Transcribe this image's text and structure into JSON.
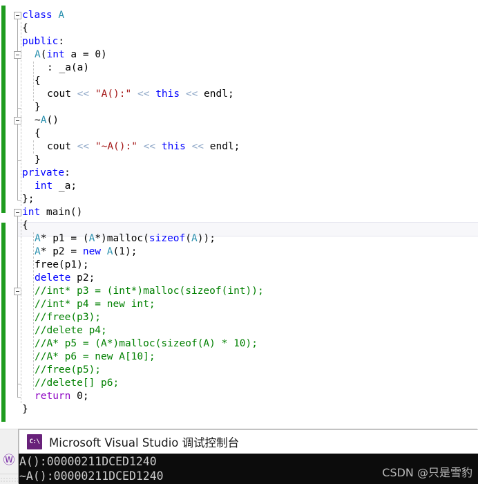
{
  "editor": {
    "language": "C++",
    "theme_colors": {
      "background": "#ffffff",
      "keyword": "#0000ff",
      "control_keyword": "#8f08c4",
      "class_type": "#2b91af",
      "string": "#a31515",
      "comment": "#008000",
      "operator": "#8fa8c8",
      "plain_text": "#000000",
      "change_bar": "#1e9b1e",
      "current_line_highlight": "#f7f7fa"
    },
    "current_line_index": 16,
    "lines": [
      {
        "indent": 0,
        "tokens": [
          {
            "t": "class ",
            "c": "kw"
          },
          {
            "t": "A",
            "c": "cls"
          }
        ]
      },
      {
        "indent": 0,
        "tokens": [
          {
            "t": "{",
            "c": "pln"
          }
        ]
      },
      {
        "indent": 0,
        "tokens": [
          {
            "t": "public",
            "c": "kw"
          },
          {
            "t": ":",
            "c": "pln"
          }
        ]
      },
      {
        "indent": 1,
        "tokens": [
          {
            "t": "A",
            "c": "cls"
          },
          {
            "t": "(",
            "c": "pln"
          },
          {
            "t": "int",
            "c": "kw"
          },
          {
            "t": " a = 0)",
            "c": "pln"
          }
        ]
      },
      {
        "indent": 2,
        "tokens": [
          {
            "t": ": _a(a)",
            "c": "pln"
          }
        ]
      },
      {
        "indent": 1,
        "tokens": [
          {
            "t": "{",
            "c": "pln"
          }
        ]
      },
      {
        "indent": 2,
        "tokens": [
          {
            "t": "cout ",
            "c": "pln"
          },
          {
            "t": "<<",
            "c": "op"
          },
          {
            "t": " ",
            "c": "pln"
          },
          {
            "t": "\"A():\"",
            "c": "str"
          },
          {
            "t": " ",
            "c": "pln"
          },
          {
            "t": "<<",
            "c": "op"
          },
          {
            "t": " ",
            "c": "pln"
          },
          {
            "t": "this",
            "c": "kw"
          },
          {
            "t": " ",
            "c": "pln"
          },
          {
            "t": "<<",
            "c": "op"
          },
          {
            "t": " endl;",
            "c": "pln"
          }
        ]
      },
      {
        "indent": 1,
        "tokens": [
          {
            "t": "}",
            "c": "pln"
          }
        ]
      },
      {
        "indent": 1,
        "tokens": [
          {
            "t": "~",
            "c": "pln"
          },
          {
            "t": "A",
            "c": "cls"
          },
          {
            "t": "()",
            "c": "pln"
          }
        ]
      },
      {
        "indent": 1,
        "tokens": [
          {
            "t": "{",
            "c": "pln"
          }
        ]
      },
      {
        "indent": 2,
        "tokens": [
          {
            "t": "cout ",
            "c": "pln"
          },
          {
            "t": "<<",
            "c": "op"
          },
          {
            "t": " ",
            "c": "pln"
          },
          {
            "t": "\"~A():\"",
            "c": "str"
          },
          {
            "t": " ",
            "c": "pln"
          },
          {
            "t": "<<",
            "c": "op"
          },
          {
            "t": " ",
            "c": "pln"
          },
          {
            "t": "this",
            "c": "kw"
          },
          {
            "t": " ",
            "c": "pln"
          },
          {
            "t": "<<",
            "c": "op"
          },
          {
            "t": " endl;",
            "c": "pln"
          }
        ]
      },
      {
        "indent": 1,
        "tokens": [
          {
            "t": "}",
            "c": "pln"
          }
        ]
      },
      {
        "indent": 0,
        "tokens": [
          {
            "t": "private",
            "c": "kw"
          },
          {
            "t": ":",
            "c": "pln"
          }
        ]
      },
      {
        "indent": 1,
        "tokens": [
          {
            "t": "int",
            "c": "kw"
          },
          {
            "t": " _a;",
            "c": "pln"
          }
        ]
      },
      {
        "indent": 0,
        "tokens": [
          {
            "t": "};",
            "c": "pln"
          }
        ]
      },
      {
        "indent": 0,
        "tokens": [
          {
            "t": "int",
            "c": "kw"
          },
          {
            "t": " main()",
            "c": "pln"
          }
        ]
      },
      {
        "indent": 0,
        "tokens": [
          {
            "t": "{",
            "c": "pln"
          }
        ]
      },
      {
        "indent": 1,
        "tokens": [
          {
            "t": "A",
            "c": "cls"
          },
          {
            "t": "* p1 = (",
            "c": "pln"
          },
          {
            "t": "A",
            "c": "cls"
          },
          {
            "t": "*)malloc(",
            "c": "pln"
          },
          {
            "t": "sizeof",
            "c": "kw"
          },
          {
            "t": "(",
            "c": "pln"
          },
          {
            "t": "A",
            "c": "cls"
          },
          {
            "t": "));",
            "c": "pln"
          }
        ]
      },
      {
        "indent": 1,
        "tokens": [
          {
            "t": "A",
            "c": "cls"
          },
          {
            "t": "* p2 = ",
            "c": "pln"
          },
          {
            "t": "new",
            "c": "kw"
          },
          {
            "t": " ",
            "c": "pln"
          },
          {
            "t": "A",
            "c": "cls"
          },
          {
            "t": "(1);",
            "c": "pln"
          }
        ]
      },
      {
        "indent": 1,
        "tokens": [
          {
            "t": "free(p1);",
            "c": "pln"
          }
        ]
      },
      {
        "indent": 1,
        "tokens": [
          {
            "t": "delete",
            "c": "kw"
          },
          {
            "t": " p2;",
            "c": "pln"
          }
        ]
      },
      {
        "indent": 1,
        "tokens": [
          {
            "t": "//int* p3 = (int*)malloc(sizeof(int));",
            "c": "cmt"
          }
        ]
      },
      {
        "indent": 1,
        "tokens": [
          {
            "t": "//int* p4 = new int;",
            "c": "cmt"
          }
        ]
      },
      {
        "indent": 1,
        "tokens": [
          {
            "t": "//free(p3);",
            "c": "cmt"
          }
        ]
      },
      {
        "indent": 1,
        "tokens": [
          {
            "t": "//delete p4;",
            "c": "cmt"
          }
        ]
      },
      {
        "indent": 1,
        "tokens": [
          {
            "t": "//A* p5 = (A*)malloc(sizeof(A) * 10);",
            "c": "cmt"
          }
        ]
      },
      {
        "indent": 1,
        "tokens": [
          {
            "t": "//A* p6 = new A[10];",
            "c": "cmt"
          }
        ]
      },
      {
        "indent": 1,
        "tokens": [
          {
            "t": "//free(p5);",
            "c": "cmt"
          }
        ]
      },
      {
        "indent": 1,
        "tokens": [
          {
            "t": "//delete[] p6;",
            "c": "cmt"
          }
        ]
      },
      {
        "indent": 1,
        "tokens": [
          {
            "t": "return",
            "c": "ctl"
          },
          {
            "t": " 0;",
            "c": "pln"
          }
        ]
      },
      {
        "indent": 0,
        "tokens": [
          {
            "t": "}",
            "c": "pln"
          }
        ]
      }
    ],
    "fold_markers": [
      {
        "line": 0,
        "state": "expanded"
      },
      {
        "line": 3,
        "state": "expanded"
      },
      {
        "line": 8,
        "state": "expanded"
      },
      {
        "line": 15,
        "state": "expanded"
      },
      {
        "line": 21,
        "state": "expanded"
      }
    ]
  },
  "console": {
    "title": "Microsoft Visual Studio 调试控制台",
    "icon": "console-app-icon",
    "icon_glyph": "C:\\",
    "output_lines": [
      "A():00000211DCED1240",
      "~A():00000211DCED1240"
    ]
  },
  "watermark": {
    "text": "CSDN @只是雪豹"
  },
  "taskbar": {
    "icon": "assistant-icon",
    "icon_glyph": "Ⓦ"
  }
}
